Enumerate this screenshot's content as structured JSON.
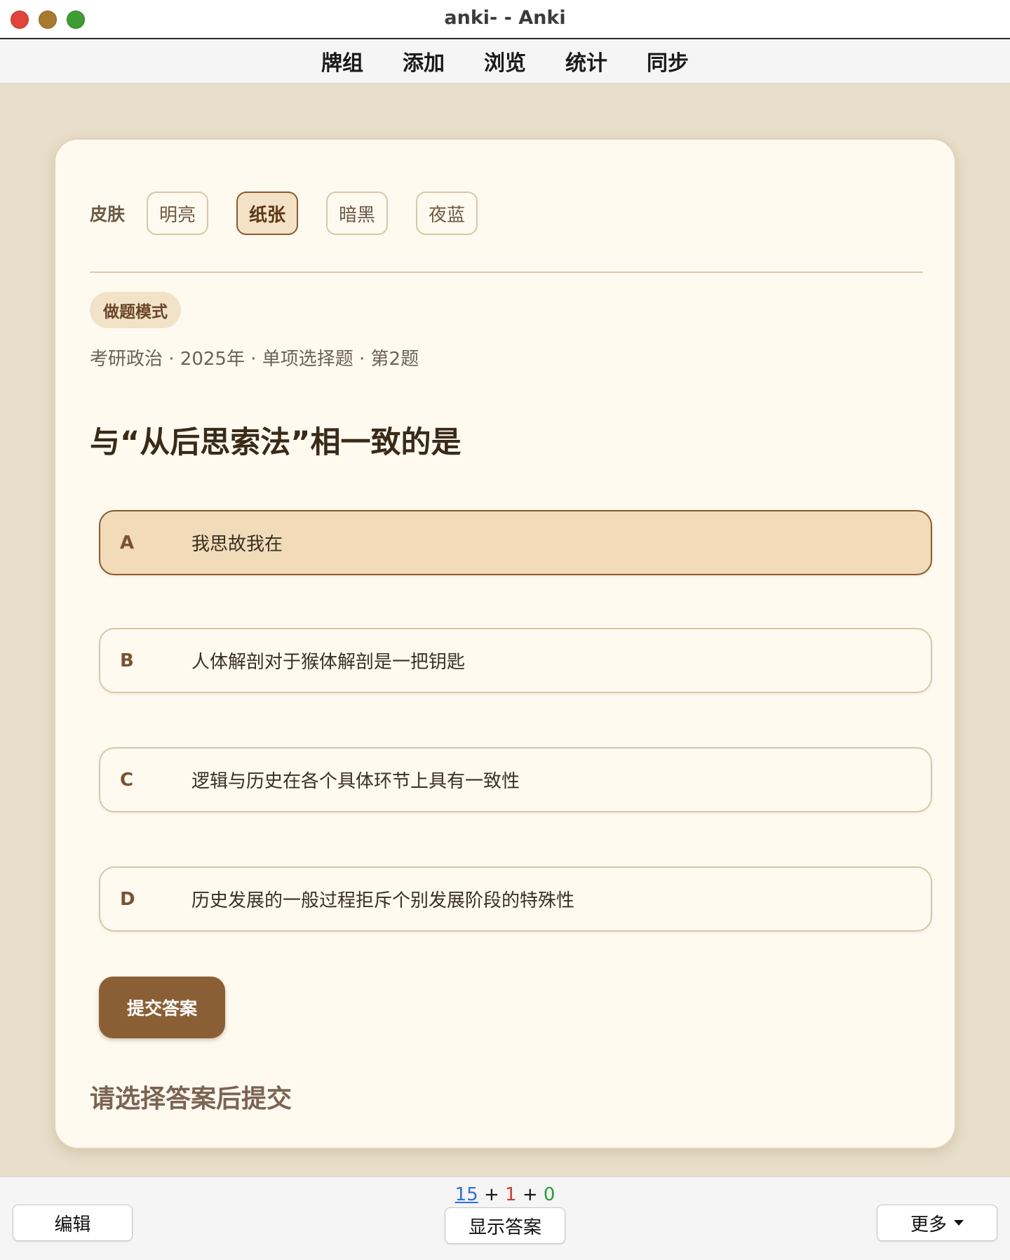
{
  "window": {
    "title": "anki- - Anki"
  },
  "toolbar": {
    "items": [
      "牌组",
      "添加",
      "浏览",
      "统计",
      "同步"
    ]
  },
  "card": {
    "skin_label": "皮肤",
    "skins": [
      "明亮",
      "纸张",
      "暗黑",
      "夜蓝"
    ],
    "active_skin": "纸张",
    "mode_badge": "做题模式",
    "meta": "考研政治 · 2025年 · 单项选择题 · 第2题",
    "question": "与“从后思索法”相一致的是",
    "options": [
      {
        "letter": "A",
        "text": "我思故我在",
        "selected": true
      },
      {
        "letter": "B",
        "text": "人体解剖对于猴体解剖是一把钥匙",
        "selected": false
      },
      {
        "letter": "C",
        "text": "逻辑与历史在各个具体环节上具有一致性",
        "selected": false
      },
      {
        "letter": "D",
        "text": "历史发展的一般过程拒斥个别发展阶段的特殊性",
        "selected": false
      }
    ],
    "submit_label": "提交答案",
    "hint": "请选择答案后提交"
  },
  "bottom": {
    "counts": {
      "new": "15",
      "learn": "1",
      "review": "0",
      "sep": "+"
    },
    "edit_label": "编辑",
    "show_answer_label": "显示答案",
    "more_label": "更多"
  },
  "colors": {
    "background": "#e8dec9",
    "card": "#fffaf0",
    "accent": "#8b5f36",
    "selected_option": "#f1dbb8",
    "count_new": "#2f6fd6",
    "count_learn": "#d23a2e",
    "count_review": "#2a9a3a"
  },
  "icons": [
    "close-icon",
    "minimize-icon",
    "maximize-icon",
    "caret-down-icon"
  ]
}
